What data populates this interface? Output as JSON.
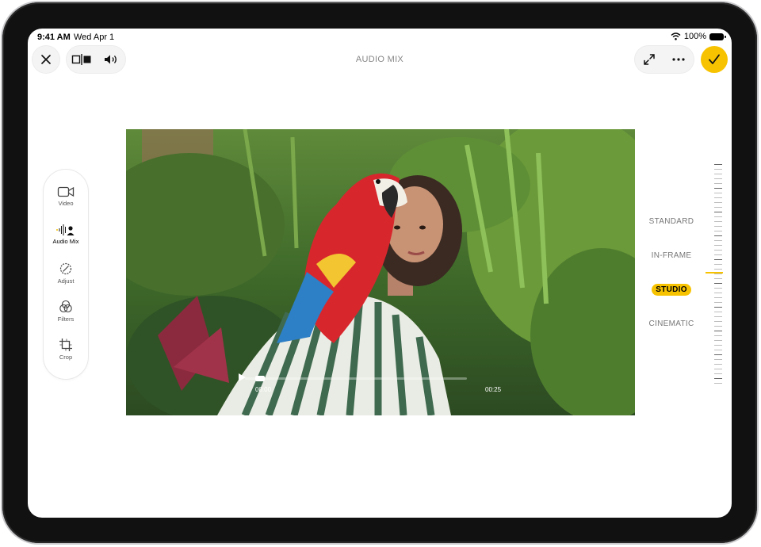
{
  "status_bar": {
    "time": "9:41 AM",
    "date": "Wed Apr 1",
    "battery": "100%"
  },
  "header": {
    "title": "AUDIO MIX"
  },
  "toolbar": {
    "items": [
      {
        "label": "Video",
        "icon": "video-camera-icon",
        "active": false
      },
      {
        "label": "Audio Mix",
        "icon": "audio-mix-icon",
        "active": true
      },
      {
        "label": "Adjust",
        "icon": "adjust-dial-icon",
        "active": false
      },
      {
        "label": "Filters",
        "icon": "filters-icon",
        "active": false
      },
      {
        "label": "Crop",
        "icon": "crop-icon",
        "active": false
      }
    ]
  },
  "player": {
    "time_start": "00:00",
    "time_end": "00:25"
  },
  "audio_modes": [
    {
      "label": "STANDARD",
      "active": false
    },
    {
      "label": "IN-FRAME",
      "active": false
    },
    {
      "label": "STUDIO",
      "active": true
    },
    {
      "label": "CINEMATIC",
      "active": false
    }
  ],
  "colors": {
    "accent": "#f7c300",
    "muted_text": "#777777"
  }
}
